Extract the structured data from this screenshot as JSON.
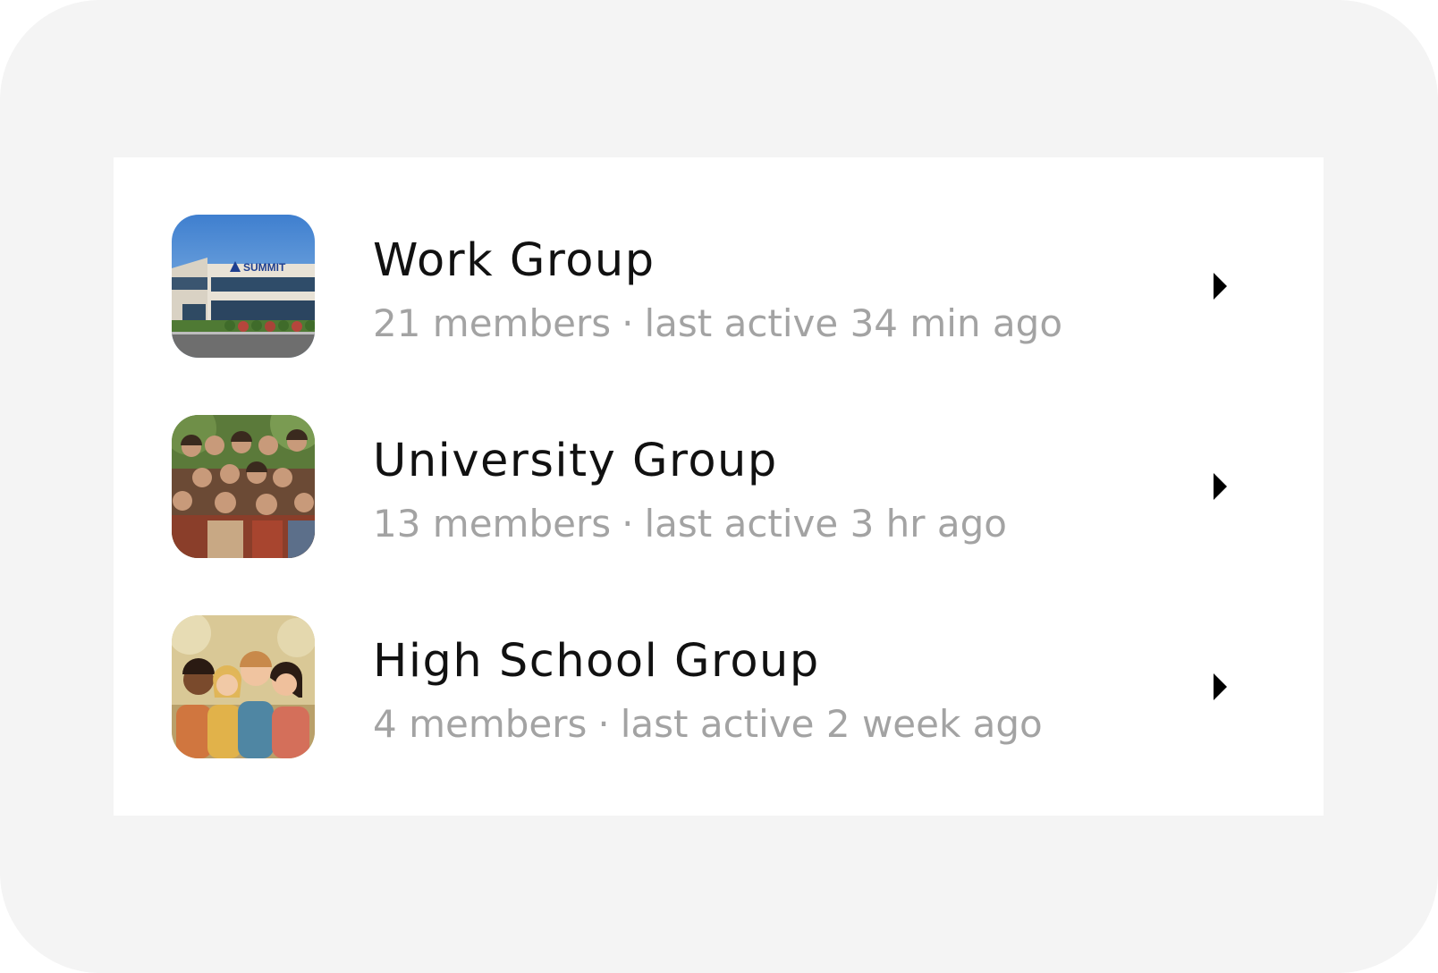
{
  "groups": [
    {
      "name": "Work Group",
      "members": "21 members",
      "separator": "·",
      "last_active": "last active 34 min ago",
      "thumbnail_icon": "office-building-photo",
      "thumbnail_sign_text": "SUMMIT"
    },
    {
      "name": "University Group",
      "members": "13 members",
      "separator": "·",
      "last_active": "last active 3 hr ago",
      "thumbnail_icon": "group-of-friends-photo"
    },
    {
      "name": "High School Group",
      "members": "4 members",
      "separator": "·",
      "last_active": "last active 2 week ago",
      "thumbnail_icon": "children-illustration"
    }
  ],
  "colors": {
    "background": "#f4f4f4",
    "panel": "#ffffff",
    "title": "#111111",
    "meta": "#a3a3a3",
    "chevron": "#000000"
  },
  "row_action_icon": "chevron-right-icon"
}
